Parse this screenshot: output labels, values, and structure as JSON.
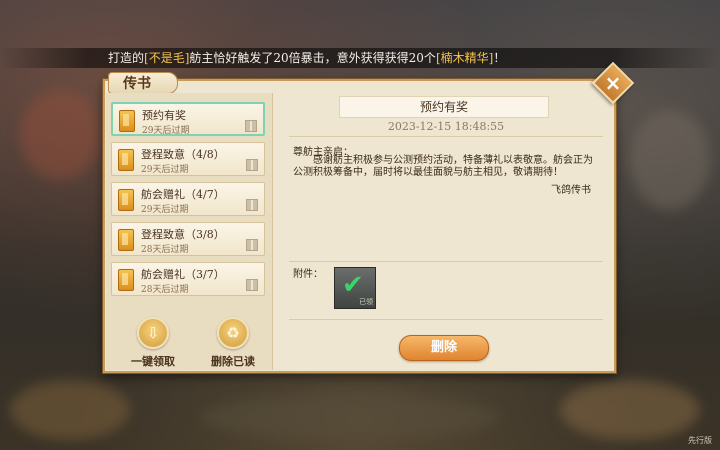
{
  "broadcast": {
    "prefix": "打造的",
    "item1": "[不是毛]",
    "middle": "舫主恰好触发了20倍暴击，意外获得获得20个",
    "item2": "[楠木精华]",
    "suffix": "！"
  },
  "panel": {
    "tab_label": "传书",
    "close_icon": "×"
  },
  "mails": [
    {
      "title": "预约有奖",
      "expire": "29天后过期",
      "selected": true
    },
    {
      "title": "登程致意（4/8）",
      "expire": "29天后过期",
      "selected": false
    },
    {
      "title": "舫会赠礼（4/7）",
      "expire": "29天后过期",
      "selected": false
    },
    {
      "title": "登程致意（3/8）",
      "expire": "28天后过期",
      "selected": false
    },
    {
      "title": "舫会赠礼（3/7）",
      "expire": "28天后过期",
      "selected": false
    }
  ],
  "actions": {
    "claim_all": "一键领取",
    "delete_read": "删除已读"
  },
  "detail": {
    "title": "预约有奖",
    "date": "2023-12-15  18:48:55",
    "salutation": "尊舫主亲启：",
    "body": "感谢舫主积极参与公测预约活动，特备薄礼以表敬意。舫会正为公测积极筹备中，届时将以最佳面貌与舫主相见，敬请期待！",
    "signature": "飞鸽传书",
    "attachment_label": "附件：",
    "attachment_tag": "已领",
    "delete_button": "删除"
  },
  "footer": {
    "corner_text": "先行版"
  },
  "colors": {
    "highlight": "#f4c451",
    "selected_border": "#7fd3b0",
    "button_orange": "#e0842f"
  }
}
